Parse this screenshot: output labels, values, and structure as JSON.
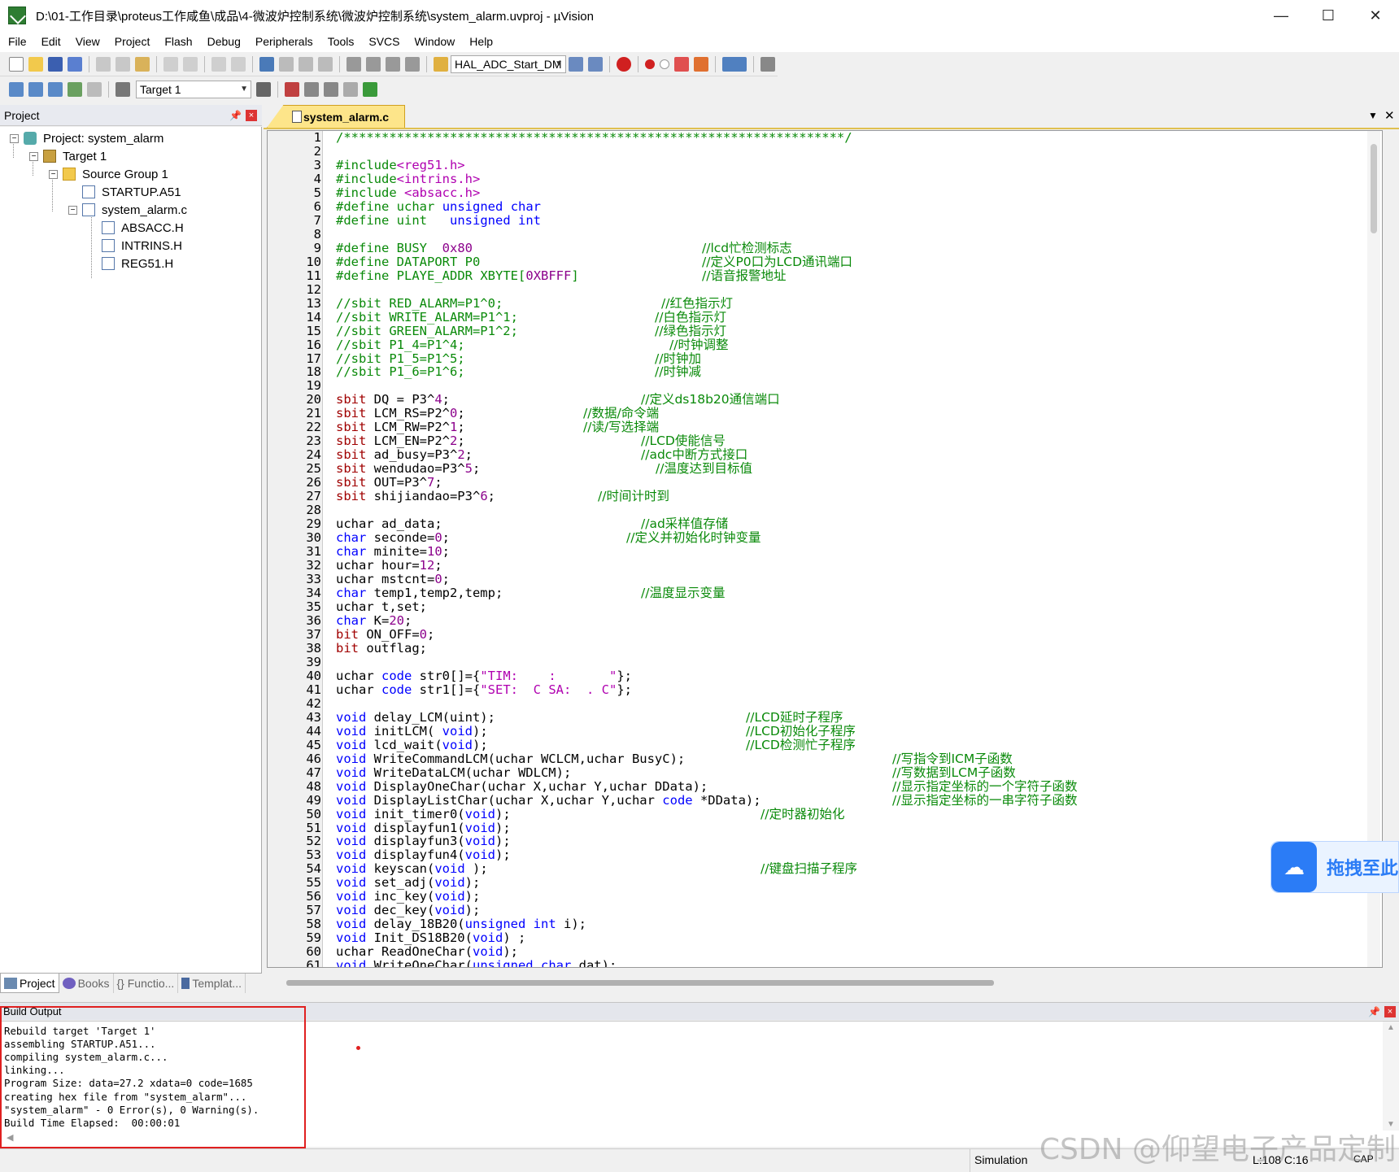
{
  "window": {
    "title": "D:\\01-工作目录\\proteus工作咸鱼\\成品\\4-微波炉控制系统\\微波炉控制系统\\system_alarm.uvproj - µVision",
    "minimize": "—",
    "maximize": "☐",
    "close": "✕"
  },
  "menu": [
    "File",
    "Edit",
    "View",
    "Project",
    "Flash",
    "Debug",
    "Peripherals",
    "Tools",
    "SVCS",
    "Window",
    "Help"
  ],
  "toolbar": {
    "find_combo": "HAL_ADC_Start_DM",
    "target_combo": "Target 1"
  },
  "project_pane": {
    "title": "Project",
    "tree": [
      {
        "label": "Project: system_alarm",
        "level": 0
      },
      {
        "label": "Target 1",
        "level": 1
      },
      {
        "label": "Source Group 1",
        "level": 2
      },
      {
        "label": "STARTUP.A51",
        "level": 3
      },
      {
        "label": "system_alarm.c",
        "level": 3
      },
      {
        "label": "ABSACC.H",
        "level": 4
      },
      {
        "label": "INTRINS.H",
        "level": 4
      },
      {
        "label": "REG51.H",
        "level": 4
      }
    ],
    "tabs": [
      "Project",
      "Books",
      "{} Functio...",
      "Templat..."
    ]
  },
  "editor": {
    "tab": "system_alarm.c",
    "lines": [
      {
        "n": "1",
        "code": "/******************************************************************/",
        "comment": ""
      },
      {
        "n": "2",
        "code": "",
        "comment": ""
      },
      {
        "n": "3",
        "code": "#include<reg51.h>",
        "comment": ""
      },
      {
        "n": "4",
        "code": "#include<intrins.h>",
        "comment": ""
      },
      {
        "n": "5",
        "code": "#include <absacc.h>",
        "comment": ""
      },
      {
        "n": "6",
        "code": "#define uchar unsigned char",
        "comment": ""
      },
      {
        "n": "7",
        "code": "#define uint   unsigned int",
        "comment": ""
      },
      {
        "n": "8",
        "code": "",
        "comment": ""
      },
      {
        "n": "9",
        "code": "#define BUSY  0x80",
        "comment": "//lcd忙检测标志"
      },
      {
        "n": "10",
        "code": "#define DATAPORT P0",
        "comment": "//定义P0口为LCD通讯端口"
      },
      {
        "n": "11",
        "code": "#define PLAYE_ADDR XBYTE[0XBFFF]",
        "comment": "//语音报警地址"
      },
      {
        "n": "12",
        "code": "",
        "comment": ""
      },
      {
        "n": "13",
        "code": "//sbit RED_ALARM=P1^0;",
        "comment": "//红色指示灯"
      },
      {
        "n": "14",
        "code": "//sbit WRITE_ALARM=P1^1;",
        "comment": "//白色指示灯"
      },
      {
        "n": "15",
        "code": "//sbit GREEN_ALARM=P1^2;",
        "comment": "//绿色指示灯"
      },
      {
        "n": "16",
        "code": "//sbit P1_4=P1^4;",
        "comment": "//时钟调整"
      },
      {
        "n": "17",
        "code": "//sbit P1_5=P1^5;",
        "comment": "//时钟加"
      },
      {
        "n": "18",
        "code": "//sbit P1_6=P1^6;",
        "comment": "//时钟减"
      },
      {
        "n": "19",
        "code": "",
        "comment": ""
      },
      {
        "n": "20",
        "code": "sbit DQ = P3^4;",
        "comment": "//定义ds18b20通信端口"
      },
      {
        "n": "21",
        "code": "sbit LCM_RS=P2^0;",
        "comment": "//数据/命令端"
      },
      {
        "n": "22",
        "code": "sbit LCM_RW=P2^1;",
        "comment": "//读/写选择端"
      },
      {
        "n": "23",
        "code": "sbit LCM_EN=P2^2;",
        "comment": "//LCD使能信号"
      },
      {
        "n": "24",
        "code": "sbit ad_busy=P3^2;",
        "comment": "//adc中断方式接口"
      },
      {
        "n": "25",
        "code": "sbit wendudao=P3^5;",
        "comment": "//温度达到目标值"
      },
      {
        "n": "26",
        "code": "sbit OUT=P3^7;",
        "comment": ""
      },
      {
        "n": "27",
        "code": "sbit shijiandao=P3^6;",
        "comment": "//时间计时到"
      },
      {
        "n": "28",
        "code": "",
        "comment": ""
      },
      {
        "n": "29",
        "code": "uchar ad_data;",
        "comment": "//ad采样值存储"
      },
      {
        "n": "30",
        "code": "char seconde=0;",
        "comment": "//定义并初始化时钟变量"
      },
      {
        "n": "31",
        "code": "char minite=10;",
        "comment": ""
      },
      {
        "n": "32",
        "code": "uchar hour=12;",
        "comment": ""
      },
      {
        "n": "33",
        "code": "uchar mstcnt=0;",
        "comment": ""
      },
      {
        "n": "34",
        "code": "char temp1,temp2,temp;",
        "comment": "//温度显示变量"
      },
      {
        "n": "35",
        "code": "uchar t,set;",
        "comment": ""
      },
      {
        "n": "36",
        "code": "char K=20;",
        "comment": ""
      },
      {
        "n": "37",
        "code": "bit ON_OFF=0;",
        "comment": ""
      },
      {
        "n": "38",
        "code": "bit outflag;",
        "comment": ""
      },
      {
        "n": "39",
        "code": "",
        "comment": ""
      },
      {
        "n": "40",
        "code": "uchar code str0[]={\"TIM:    :       \"};",
        "comment": ""
      },
      {
        "n": "41",
        "code": "uchar code str1[]={\"SET:  C SA:  . C\"};",
        "comment": ""
      },
      {
        "n": "42",
        "code": "",
        "comment": ""
      },
      {
        "n": "43",
        "code": "void delay_LCM(uint);",
        "comment": "//LCD延时子程序"
      },
      {
        "n": "44",
        "code": "void initLCM( void);",
        "comment": "//LCD初始化子程序"
      },
      {
        "n": "45",
        "code": "void lcd_wait(void);",
        "comment": "//LCD检测忙子程序"
      },
      {
        "n": "46",
        "code": "void WriteCommandLCM(uchar WCLCM,uchar BusyC);",
        "comment": "//写指令到ICM子函数"
      },
      {
        "n": "47",
        "code": "void WriteDataLCM(uchar WDLCM);",
        "comment": "//写数据到LCM子函数"
      },
      {
        "n": "48",
        "code": "void DisplayOneChar(uchar X,uchar Y,uchar DData);",
        "comment": "//显示指定坐标的一个字符子函数"
      },
      {
        "n": "49",
        "code": "void DisplayListChar(uchar X,uchar Y,uchar code *DData);",
        "comment": "//显示指定坐标的一串字符子函数"
      },
      {
        "n": "50",
        "code": "void init_timer0(void);",
        "comment": "//定时器初始化"
      },
      {
        "n": "51",
        "code": "void displayfun1(void);",
        "comment": ""
      },
      {
        "n": "52",
        "code": "void displayfun3(void);",
        "comment": ""
      },
      {
        "n": "53",
        "code": "void displayfun4(void);",
        "comment": ""
      },
      {
        "n": "54",
        "code": "void keyscan(void );",
        "comment": "//键盘扫描子程序"
      },
      {
        "n": "55",
        "code": "void set_adj(void);",
        "comment": ""
      },
      {
        "n": "56",
        "code": "void inc_key(void);",
        "comment": ""
      },
      {
        "n": "57",
        "code": "void dec_key(void);",
        "comment": ""
      },
      {
        "n": "58",
        "code": "void delay_18B20(unsigned int i);",
        "comment": ""
      },
      {
        "n": "59",
        "code": "void Init_DS18B20(void) ;",
        "comment": ""
      },
      {
        "n": "60",
        "code": "uchar ReadOneChar(void);",
        "comment": ""
      },
      {
        "n": "61",
        "code": "void WriteOneChar(unsigned char dat);",
        "comment": ""
      }
    ]
  },
  "build_output": {
    "title": "Build Output",
    "lines": [
      "Rebuild target 'Target 1'",
      "assembling STARTUP.A51...",
      "compiling system_alarm.c...",
      "linking...",
      "Program Size: data=27.2 xdata=0 code=1685",
      "creating hex file from \"system_alarm\"...",
      "\"system_alarm\" - 0 Error(s), 0 Warning(s).",
      "Build Time Elapsed:  00:00:01"
    ]
  },
  "status": {
    "mode": "Simulation",
    "position": "L:108 C:16",
    "caps": "CAP"
  },
  "overlay": {
    "baidu_text": "拖拽至此",
    "watermark": "CSDN @仰望电子产品定制"
  }
}
